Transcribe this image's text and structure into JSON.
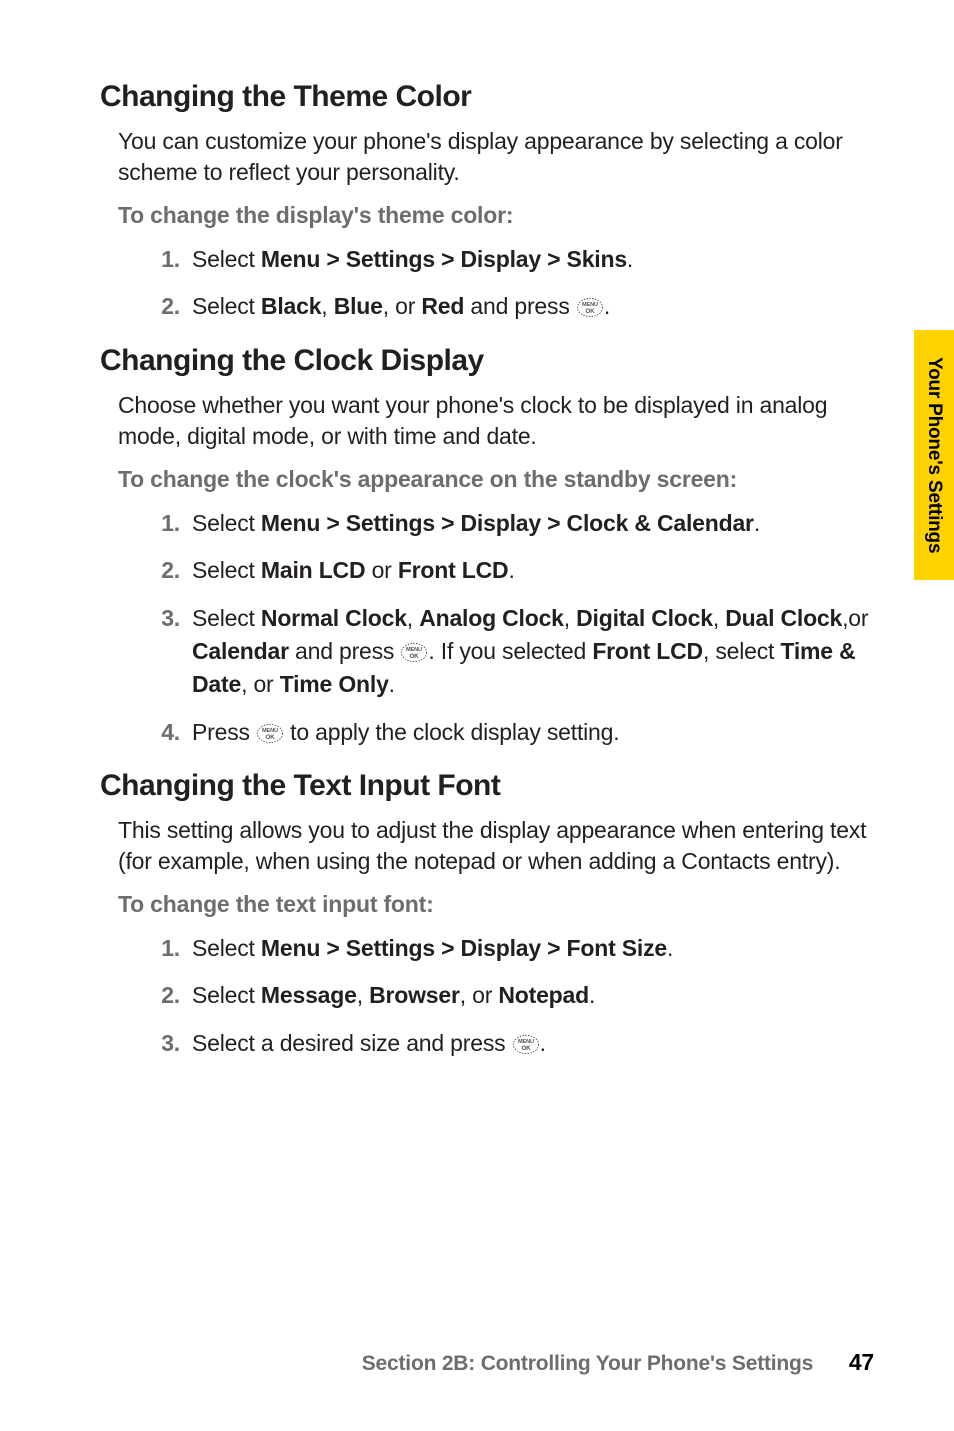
{
  "side_tab": "Your Phone's Settings",
  "footer": {
    "section": "Section 2B: Controlling Your Phone's Settings",
    "page": "47"
  },
  "s1": {
    "title": "Changing the Theme Color",
    "intro": "You can customize your phone's display appearance by selecting a color scheme to reflect your personality.",
    "lead": "To change the display's theme color:",
    "step1_a": "Select ",
    "step1_b": "Menu > Settings > Display > Skins",
    "step1_c": ".",
    "step2_a": "Select ",
    "step2_b": "Black",
    "step2_c": ", ",
    "step2_d": "Blue",
    "step2_e": ", or ",
    "step2_f": "Red",
    "step2_g": " and press ",
    "step2_h": "."
  },
  "s2": {
    "title": "Changing the Clock Display",
    "intro": "Choose whether you want your phone's clock to be displayed in analog mode, digital mode, or with time and date.",
    "lead": "To change the clock's appearance on the standby screen:",
    "step1_a": "Select ",
    "step1_b": "Menu > Settings > Display > Clock & Calendar",
    "step1_c": ".",
    "step2_a": "Select ",
    "step2_b": "Main LCD",
    "step2_c": " or ",
    "step2_d": "Front LCD",
    "step2_e": ".",
    "step3_a": "Select ",
    "step3_b": "Normal Clock",
    "step3_c": ", ",
    "step3_d": "Analog Clock",
    "step3_e": ", ",
    "step3_f": "Digital Clock",
    "step3_g": ", ",
    "step3_h": "Dual Clock",
    "step3_i": ",or ",
    "step3_j": "Calendar",
    "step3_k": " and press ",
    "step3_l": ". If you selected ",
    "step3_m": "Front LCD",
    "step3_n": ", select ",
    "step3_o": "Time & Date",
    "step3_p": ", or ",
    "step3_q": "Time Only",
    "step3_r": ".",
    "step4_a": "Press ",
    "step4_b": " to apply the clock display setting."
  },
  "s3": {
    "title": "Changing the Text Input Font",
    "intro": "This setting allows you to adjust the display appearance when entering text (for example, when using the notepad or when adding a Contacts entry).",
    "lead": "To change the text input font:",
    "step1_a": "Select ",
    "step1_b": "Menu > Settings > Display > Font Size",
    "step1_c": ".",
    "step2_a": "Select ",
    "step2_b": "Message",
    "step2_c": ", ",
    "step2_d": "Browser",
    "step2_e": ", or ",
    "step2_f": "Notepad",
    "step2_g": ".",
    "step3_a": "Select a desired size and press ",
    "step3_b": "."
  }
}
